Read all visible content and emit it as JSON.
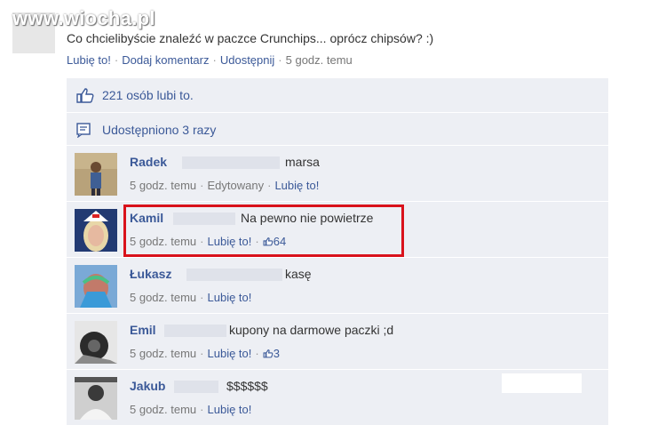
{
  "watermark": "www.wiocha.pl",
  "post": {
    "text": "Co chcielibyście znaleźć w paczce Crunchips... oprócz chipsów? :)",
    "like_label": "Lubię to!",
    "comment_label": "Dodaj komentarz",
    "share_label": "Udostępnij",
    "time": "5 godz. temu",
    "separator": "·"
  },
  "likes": {
    "text": "221 osób lubi to.",
    "icon": "thumbs-up-icon"
  },
  "shares": {
    "text": "Udostępniono 3 razy",
    "icon": "share-icon"
  },
  "comments": [
    {
      "name": "Radek",
      "text": "marsa",
      "time": "5 godz. temu",
      "edited": "Edytowany",
      "like_label": "Lubię to!"
    },
    {
      "name": "Kamil",
      "text": "Na pewno nie powietrze",
      "time": "5 godz. temu",
      "like_label": "Lubię to!",
      "likes": "64"
    },
    {
      "name": "Łukasz",
      "text": "kasę",
      "time": "5 godz. temu",
      "like_label": "Lubię to!"
    },
    {
      "name": "Emil",
      "text": "kupony na darmowe paczki ;d",
      "time": "5 godz. temu",
      "like_label": "Lubię to!",
      "likes": "3"
    },
    {
      "name": "Jakub",
      "text": "$$$$$$",
      "time": "5 godz. temu",
      "like_label": "Lubię to!"
    }
  ],
  "colors": {
    "link": "#3b5998",
    "panel": "#edeff4",
    "highlight": "#d9121b"
  }
}
